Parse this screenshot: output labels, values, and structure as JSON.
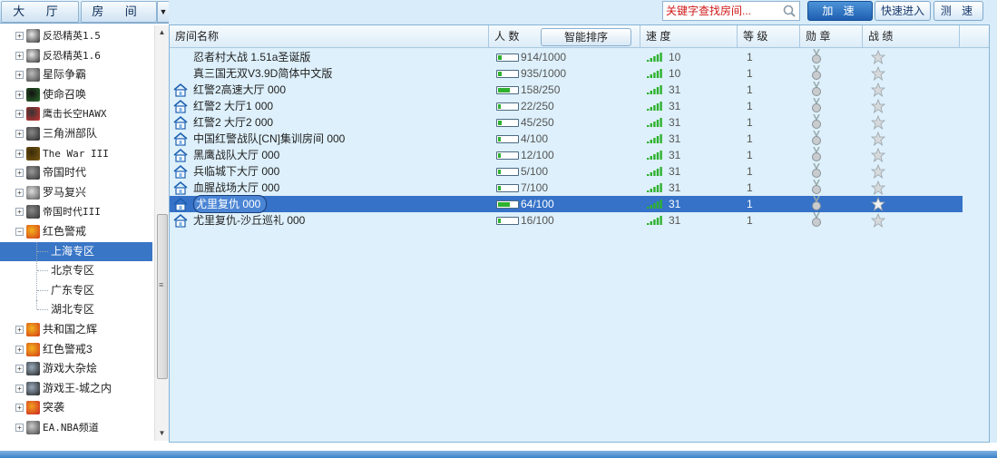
{
  "left_tabs": {
    "hall": "大 厅",
    "room": "房 间"
  },
  "tree": [
    {
      "label": "反恐精英1.5",
      "mono": true,
      "icon": "cs-icon"
    },
    {
      "label": "反恐精英1.6",
      "mono": true,
      "icon": "cs-icon"
    },
    {
      "label": "星际争霸",
      "mono": false,
      "icon": "starcraft-icon"
    },
    {
      "label": "使命召唤",
      "mono": false,
      "icon": "cod-icon"
    },
    {
      "label": "鹰击长空HAWX",
      "mono": true,
      "icon": "hawx-icon"
    },
    {
      "label": "三角洲部队",
      "mono": false,
      "icon": "delta-icon"
    },
    {
      "label": "The War III",
      "mono": true,
      "icon": "war3-icon"
    },
    {
      "label": "帝国时代",
      "mono": false,
      "icon": "aoe-icon"
    },
    {
      "label": "罗马复兴",
      "mono": false,
      "icon": "rome-icon"
    },
    {
      "label": "帝国时代III",
      "mono": true,
      "icon": "aoe3-icon"
    },
    {
      "label": "红色警戒",
      "mono": false,
      "icon": "redalert-icon",
      "expanded": true
    },
    {
      "label": "上海专区",
      "child": true,
      "selected": true
    },
    {
      "label": "北京专区",
      "child": true
    },
    {
      "label": "广东专区",
      "child": true
    },
    {
      "label": "湖北专区",
      "child": true
    },
    {
      "label": "共和国之辉",
      "mono": false,
      "icon": "redalert-icon"
    },
    {
      "label": "红色警戒3",
      "mono": false,
      "icon": "redalert-icon"
    },
    {
      "label": "游戏大杂烩",
      "mono": false,
      "icon": "misc-game-icon"
    },
    {
      "label": "游戏王-城之内",
      "mono": false,
      "icon": "misc-game-icon"
    },
    {
      "label": "突袭",
      "mono": false,
      "icon": "sudden-strike-icon"
    },
    {
      "label": "EA.NBA频道",
      "mono": true,
      "icon": "nba-icon"
    }
  ],
  "toolbar": {
    "search_placeholder": "关键字查找房间...",
    "accelerate": "加 速",
    "quick_enter": "快速进入",
    "speed_test": "测 速"
  },
  "columns": {
    "name": "房间名称",
    "players": "人 数",
    "smart_sort": "智能排序",
    "speed": "速 度",
    "level": "等 级",
    "medal": "勋 章",
    "record": "战 绩"
  },
  "rooms": [
    {
      "name": "忍者村大战 1.51a圣诞版",
      "players": "914/1000",
      "fill": 0.2,
      "speed": "10",
      "level": "1",
      "house": false
    },
    {
      "name": "真三国无双V3.9D简体中文版",
      "players": "935/1000",
      "fill": 0.2,
      "speed": "10",
      "level": "1",
      "house": false
    },
    {
      "name": "红警2高速大厅 000",
      "players": "158/250",
      "fill": 0.6,
      "speed": "31",
      "level": "1",
      "house": true
    },
    {
      "name": "红警2 大厅1 000",
      "players": "22/250",
      "fill": 0.1,
      "speed": "31",
      "level": "1",
      "house": true
    },
    {
      "name": "红警2 大厅2 000",
      "players": "45/250",
      "fill": 0.2,
      "speed": "31",
      "level": "1",
      "house": true
    },
    {
      "name": "中国红警战队[CN]集训房间 000",
      "players": "4/100",
      "fill": 0.05,
      "speed": "31",
      "level": "1",
      "house": true
    },
    {
      "name": "黑鹰战队大厅 000",
      "players": "12/100",
      "fill": 0.12,
      "speed": "31",
      "level": "1",
      "house": true
    },
    {
      "name": "兵临城下大厅 000",
      "players": "5/100",
      "fill": 0.05,
      "speed": "31",
      "level": "1",
      "house": true
    },
    {
      "name": "血腥战场大厅 000",
      "players": "7/100",
      "fill": 0.07,
      "speed": "31",
      "level": "1",
      "house": true
    },
    {
      "name": "尤里复仇 000",
      "players": "64/100",
      "fill": 0.64,
      "speed": "31",
      "level": "1",
      "house": true,
      "selected": true
    },
    {
      "name": "尤里复仇-沙丘巡礼 000",
      "players": "16/100",
      "fill": 0.16,
      "speed": "31",
      "level": "1",
      "house": true
    }
  ],
  "colors": {
    "selection": "#3572c8",
    "speed_bars": "#2fb12f",
    "accent": "#1e5fb0"
  }
}
